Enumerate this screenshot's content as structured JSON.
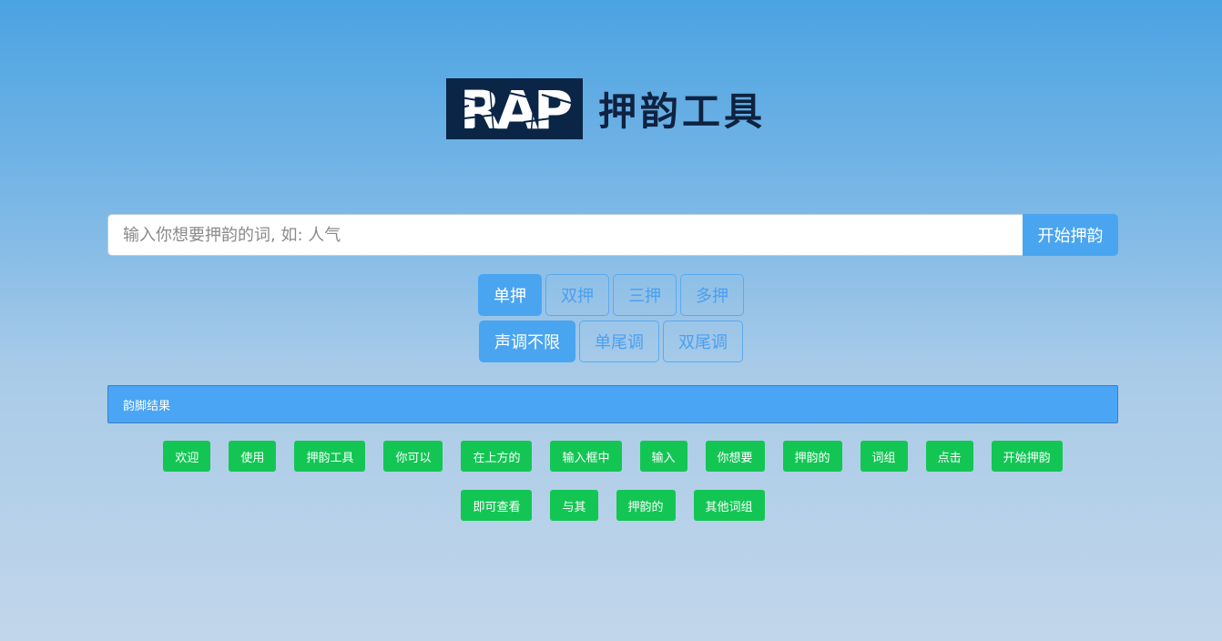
{
  "header": {
    "logo_text": "RAP",
    "title": "押韵工具"
  },
  "search": {
    "placeholder": "输入你想要押韵的词, 如: 人气",
    "value": "",
    "button_label": "开始押韵"
  },
  "rhyme_mode": {
    "options": [
      "单押",
      "双押",
      "三押",
      "多押"
    ],
    "selected": "单押"
  },
  "tone_mode": {
    "options": [
      "声调不限",
      "单尾调",
      "双尾调"
    ],
    "selected": "声调不限"
  },
  "results": {
    "title": "韵脚结果",
    "items": [
      "欢迎",
      "使用",
      "押韵工具",
      "你可以",
      "在上方的",
      "输入框中",
      "输入",
      "你想要",
      "押韵的",
      "词组",
      "点击",
      "开始押韵",
      "即可查看",
      "与其",
      "押韵的",
      "其他词组"
    ]
  },
  "colors": {
    "primary": "#4aa5f0",
    "tag_green": "#13c654",
    "logo_bg": "#0b2546",
    "title_color": "#0f2240"
  }
}
